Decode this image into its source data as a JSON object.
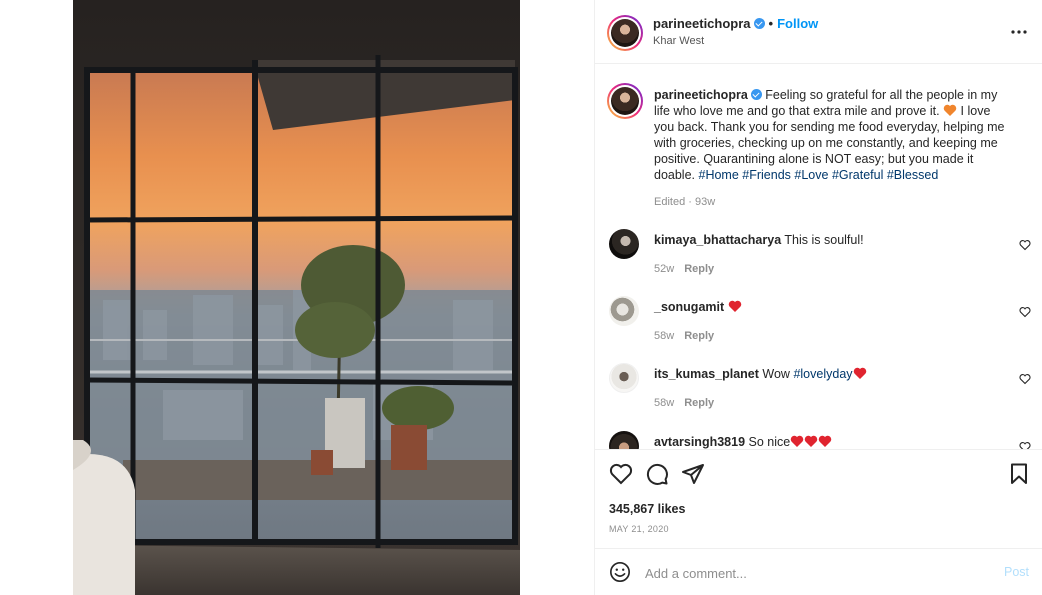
{
  "post": {
    "username": "parineetichopra",
    "verified": true,
    "follow_label": "Follow",
    "location": "Khar West",
    "more_icon": "more-horizontal-icon"
  },
  "caption": {
    "username": "parineetichopra",
    "text_1": "Feeling so grateful for all the people in my life who love me and go that extra mile and prove it.",
    "text_2": "I love you back. Thank you for sending me food everyday, helping me with groceries, checking up on me constantly, and keeping me positive. Quarantining alone is NOT easy; but you made it doable.",
    "hashtags": [
      "#Home",
      "#Friends",
      "#Love",
      "#Grateful",
      "#Blessed"
    ],
    "meta": "Edited · 93w"
  },
  "comments": [
    {
      "username": "kimaya_bhattacharya",
      "text": "This is soulful!",
      "age": "52w",
      "reply_label": "Reply"
    },
    {
      "username": "_sonugamit",
      "text": "",
      "age": "58w",
      "reply_label": "Reply"
    },
    {
      "username": "its_kumas_planet",
      "text": "Wow",
      "tag": "#lovelyday",
      "age": "58w",
      "reply_label": "Reply"
    },
    {
      "username": "avtarsingh3819",
      "text": "So nice",
      "age": "",
      "reply_label": ""
    }
  ],
  "engagement": {
    "likes": "345,867 likes",
    "date": "May 21, 2020"
  },
  "composer": {
    "placeholder": "Add a comment...",
    "post_label": "Post"
  },
  "colors": {
    "accent": "#0095f6",
    "hashtag": "#00376b",
    "heart": "#ed4956",
    "muted": "#8e8e8e"
  }
}
